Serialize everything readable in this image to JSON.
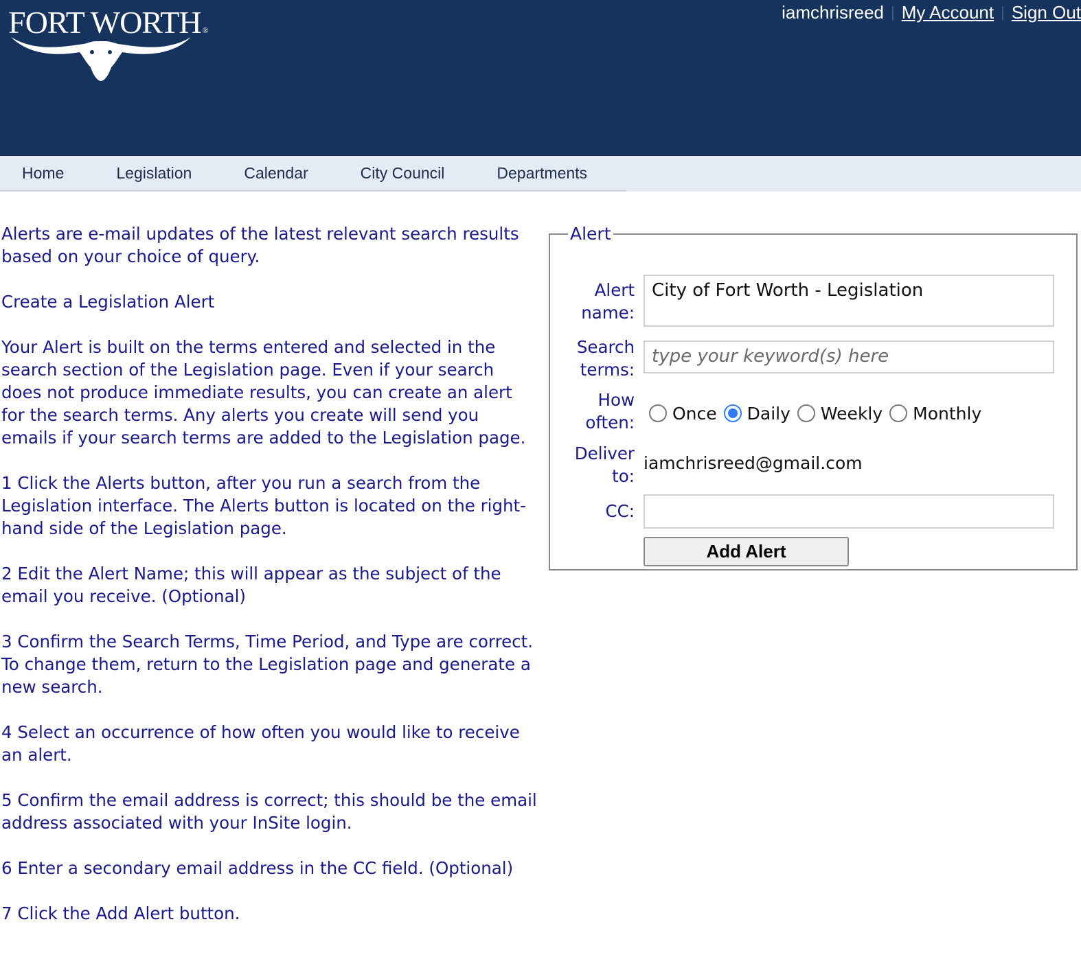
{
  "header": {
    "logo_text": "FORT WORTH",
    "logo_registered": "®",
    "username": "iamchrisreed",
    "my_account": "My Account",
    "sign_out": "Sign Out"
  },
  "nav": {
    "items": [
      "Home",
      "Legislation",
      "Calendar",
      "City Council",
      "Departments"
    ]
  },
  "instructions": [
    "Alerts are e-mail updates of the latest relevant search results based on your choice of query.",
    "Create a Legislation Alert",
    "Your Alert is built on the terms entered and selected in the search section of the Legislation page. Even if your search does not produce immediate results, you can create an alert for the search terms. Any alerts you create will send you emails if your search terms are added to the Legislation page.",
    "1 Click the Alerts button, after you run a search from the Legislation interface. The Alerts button is located on the right-hand side of the Legislation page.",
    "2 Edit the Alert Name; this will appear as the subject of the email you receive. (Optional)",
    "3 Confirm the Search Terms, Time Period, and Type are correct. To change them, return to the Legislation page and generate a new search.",
    "4 Select an occurrence of how often you would like to receive an alert.",
    "5 Confirm the email address is correct; this should be the email address associated with your InSite login.",
    "6 Enter a secondary email address in the CC field. (Optional)",
    "7 Click the Add Alert button."
  ],
  "alert_form": {
    "legend": "Alert",
    "alert_name_label_1": "Alert",
    "alert_name_label_2": "name:",
    "alert_name_value": "City of Fort Worth - Legislation",
    "search_label_1": "Search",
    "search_label_2": "terms:",
    "search_placeholder": "type your keyword(s) here",
    "often_label_1": "How",
    "often_label_2": "often:",
    "frequency_options": [
      "Once",
      "Daily",
      "Weekly",
      "Monthly"
    ],
    "frequency_selected": "Daily",
    "deliver_label_1": "Deliver",
    "deliver_label_2": "to:",
    "deliver_email": "iamchrisreed@gmail.com",
    "cc_label": "CC:",
    "cc_value": "",
    "add_button": "Add Alert"
  }
}
